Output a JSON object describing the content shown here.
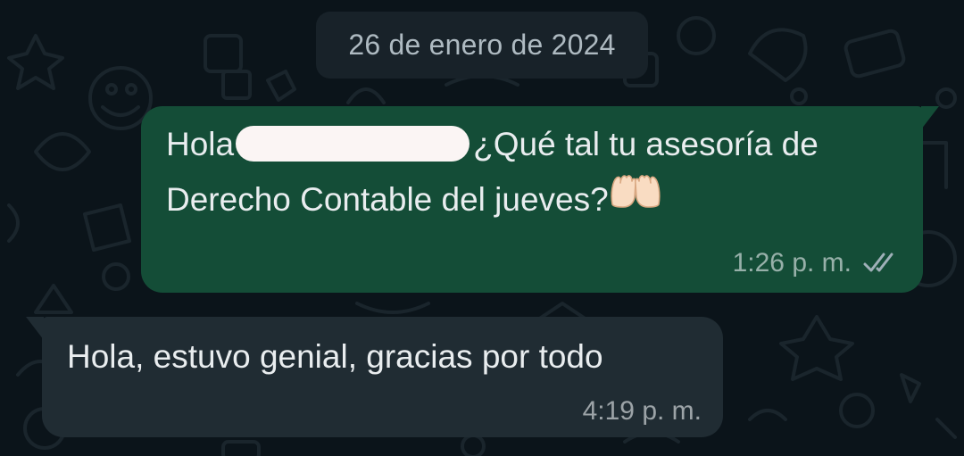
{
  "date_separator": "26 de enero de 2024",
  "messages": [
    {
      "direction": "outgoing",
      "text_before": "Hola",
      "text_after": "¿Qué tal tu asesoría de",
      "line2": "Derecho Contable del jueves?",
      "emoji": "palms-up-together",
      "time": "1:26 p. m.",
      "status": "read",
      "status_icon": "double-check-icon"
    },
    {
      "direction": "incoming",
      "text": "Hola, estuvo genial, gracias por todo",
      "time": "4:19 p. m."
    }
  ],
  "colors": {
    "background": "#0b141a",
    "outgoing_bubble": "#144d37",
    "incoming_bubble": "#202c33",
    "date_chip": "#182229",
    "date_text": "#aebac1",
    "text": "#e9edef"
  }
}
